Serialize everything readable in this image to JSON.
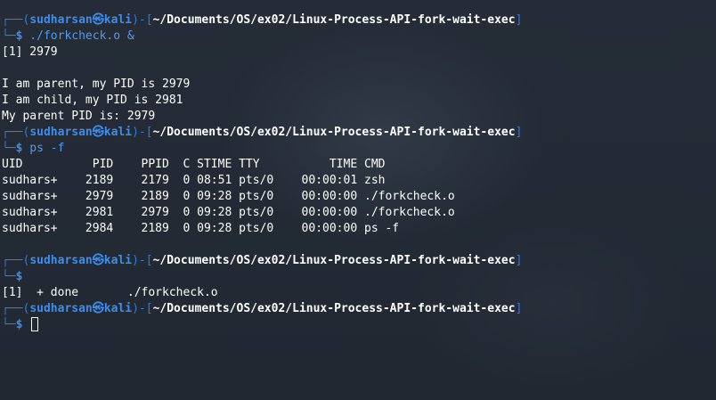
{
  "prompt": {
    "frame_open": "┌──(",
    "user": "sudharsan",
    "host_separator": "㉿",
    "host": "kali",
    "path_open": ")-[",
    "path": "~/Documents/OS/ex02/Linux-Process-API-fork-wait-exec",
    "path_close": "]",
    "second_line_prefix": "└─",
    "dollar": "$"
  },
  "blocks": [
    {
      "command": " ./forkcheck.o &",
      "output": [
        "[1] 2979",
        "",
        "I am parent, my PID is 2979",
        "I am child, my PID is 2981",
        "My parent PID is: 2979"
      ]
    },
    {
      "command": " ps -f",
      "output": [
        "UID          PID    PPID  C STIME TTY          TIME CMD",
        "sudhars+    2189    2179  0 08:51 pts/0    00:00:01 zsh",
        "sudhars+    2979    2189  0 09:28 pts/0    00:00:00 ./forkcheck.o",
        "sudhars+    2981    2979  0 09:28 pts/0    00:00:00 ./forkcheck.o",
        "sudhars+    2984    2189  0 09:28 pts/0    00:00:00 ps -f",
        ""
      ]
    },
    {
      "command": "",
      "output": [
        "[1]  + done       ./forkcheck.o"
      ]
    },
    {
      "command": " ",
      "output": []
    }
  ],
  "colors": {
    "background": "#232a35",
    "prompt_frame": "#2e7bd8",
    "prompt_user": "#3a8ef0",
    "command_text": "#4f9cf3",
    "output_text": "#ffffff"
  }
}
